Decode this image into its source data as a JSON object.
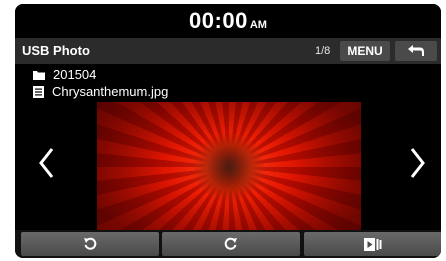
{
  "status_bar": {
    "time": "00:00",
    "ampm": "AM"
  },
  "title_bar": {
    "title": "USB Photo",
    "page_count": "1/8",
    "menu_label": "MENU"
  },
  "file_info": {
    "folder": "201504",
    "file_name": "Chrysanthemum.jpg"
  },
  "icons": {
    "back": "back-arrow-icon",
    "folder": "folder-icon",
    "file": "file-icon",
    "prev": "chevron-left-icon",
    "next": "chevron-right-icon",
    "rotate_left": "rotate-left-icon",
    "rotate_right": "rotate-right-icon",
    "slideshow": "slideshow-icon"
  },
  "colors": {
    "background": "#0d0d0d",
    "title_bar": "#2b2b2b",
    "button": "#4a4a4a",
    "text": "#ffffff"
  }
}
